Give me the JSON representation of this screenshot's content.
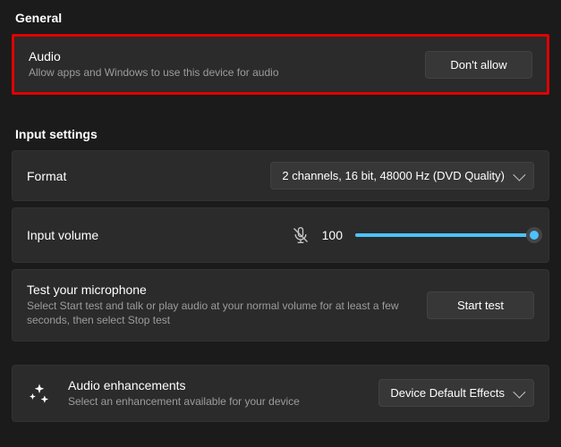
{
  "general": {
    "header": "General",
    "audio": {
      "title": "Audio",
      "subtitle": "Allow apps and Windows to use this device for audio",
      "button": "Don't allow"
    }
  },
  "input": {
    "header": "Input settings",
    "format": {
      "label": "Format",
      "selected": "2 channels, 16 bit, 48000 Hz (DVD Quality)"
    },
    "volume": {
      "label": "Input volume",
      "value": "100",
      "percent": 100
    },
    "test": {
      "title": "Test your microphone",
      "subtitle": "Select Start test and talk or play audio at your normal volume for at least a few seconds, then select Stop test",
      "button": "Start test"
    },
    "enhancements": {
      "title": "Audio enhancements",
      "subtitle": "Select an enhancement available for your device",
      "selected": "Device Default Effects"
    }
  },
  "icons": {
    "mic_muted": "mic-muted-icon",
    "sparkle": "sparkle-icon",
    "chevron": "chevron-down-icon"
  }
}
